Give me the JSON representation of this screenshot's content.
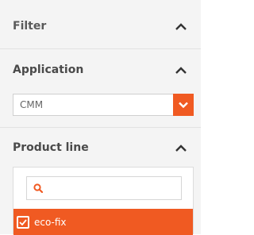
{
  "filter": {
    "title": "Filter",
    "icon": "chevron-up-icon"
  },
  "application": {
    "title": "Application",
    "icon": "chevron-up-icon",
    "select": {
      "value": "CMM",
      "arrow_icon": "chevron-down-icon"
    }
  },
  "product_line": {
    "title": "Product line",
    "icon": "chevron-up-icon",
    "search": {
      "value": "",
      "placeholder": "",
      "icon": "search-icon"
    },
    "options": [
      {
        "label": "eco-fix",
        "checked": true
      }
    ]
  },
  "colors": {
    "accent": "#f05a22",
    "panel_bg": "#f4f4f4",
    "text": "#4a4a4a"
  }
}
